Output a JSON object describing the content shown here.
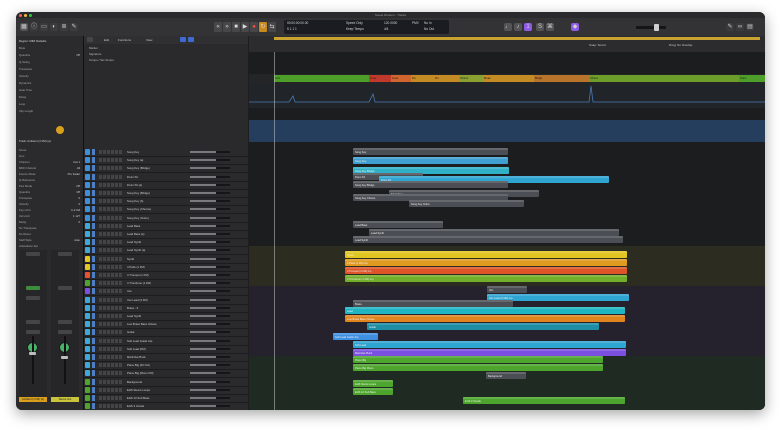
{
  "window": {
    "title": "Sweet Dreams - Tracks"
  },
  "colors": {
    "close": "#ff5f57",
    "min": "#febc2e",
    "max": "#28c840",
    "accent": "#8e5ae6"
  },
  "control_bar": {
    "lcd": {
      "position": "00:00:00:00.00",
      "bars": "5 1 1 1",
      "tempo_label": "Keep Tempo",
      "tempo": "120.0000",
      "signature": "4/4",
      "key": "No In",
      "division": "No Out",
      "time_label": "Speed Only",
      "sample_label": "PMV"
    },
    "icons": [
      "library-icon",
      "inspector-icon",
      "toolbar-icon",
      "smart-controls-icon",
      "mixer-icon",
      "editors-icon",
      "rewind-icon",
      "forward-icon",
      "stop-icon",
      "play-icon",
      "record-icon",
      "cycle-icon",
      "metronome-icon",
      "tuner-icon",
      "count-in-icon",
      "notepad-icon",
      "loop-browser-icon",
      "browser-icon"
    ]
  },
  "inspector": {
    "region_label": "Region: MIDI Defaults",
    "track_label": "Track: Ambient (1 FM) (a)",
    "rows": [
      {
        "label": "Mute",
        "value": ""
      },
      {
        "label": "Quantize",
        "value": "Off"
      },
      {
        "label": "Q-Swing",
        "value": ""
      },
      {
        "label": "Transpose",
        "value": ""
      },
      {
        "label": "Velocity",
        "value": ""
      },
      {
        "label": "Dynamics",
        "value": ""
      },
      {
        "label": "Gate Time",
        "value": ""
      },
      {
        "label": "Delay",
        "value": ""
      },
      {
        "label": "Loop",
        "value": ""
      },
      {
        "label": "Clip Length",
        "value": ""
      },
      {
        "label": "Score",
        "value": ""
      },
      {
        "label": "Icon",
        "value": ""
      },
      {
        "label": "Channel",
        "value": "Inst 1"
      },
      {
        "label": "MIDI Channel",
        "value": "All"
      },
      {
        "label": "Freeze Mode",
        "value": "Pre Fader"
      },
      {
        "label": "Q-Reference",
        "value": ""
      },
      {
        "label": "Flex Mode",
        "value": "Off"
      },
      {
        "label": "Quantize",
        "value": "Off"
      },
      {
        "label": "Transpose",
        "value": "0"
      },
      {
        "label": "Velocity",
        "value": "0"
      },
      {
        "label": "Key Limit",
        "value": "C-2 G8"
      },
      {
        "label": "Vel Limit",
        "value": "1 127"
      },
      {
        "label": "Delay",
        "value": "0"
      },
      {
        "label": "No Transpose",
        "value": ""
      },
      {
        "label": "No Reset",
        "value": ""
      },
      {
        "label": "Staff Style",
        "value": "Auto"
      },
      {
        "label": "Articulation Set",
        "value": ""
      }
    ],
    "strips": [
      {
        "name": "Ambient (1 FM) (a)",
        "setting": "Setting",
        "eq": "EQ",
        "output": "Stereo Out",
        "volume": "-9.4",
        "read": "Read"
      },
      {
        "name": "Stereo Out",
        "setting": "Setting",
        "eq": "EQ",
        "output": "",
        "volume": "0.0",
        "read": "Read"
      }
    ]
  },
  "tracks_header": {
    "edit": "Edit",
    "functions": "Functions",
    "view": "View"
  },
  "global_tracks": [
    "Marker",
    "Signature",
    "Tempo / Set Tempo"
  ],
  "tracks": [
    {
      "name": "Song Key",
      "color": "#3f8fd6"
    },
    {
      "name": "Song Key (a)",
      "color": "#3f8fd6"
    },
    {
      "name": "Song Key (Bridge)",
      "color": "#3f8fd6"
    },
    {
      "name": "Drum Kit",
      "color": "#3f8fd6"
    },
    {
      "name": "Drum Kit (a)",
      "color": "#3f8fd6"
    },
    {
      "name": "Song Key (Bridge)",
      "color": "#3f8fd6"
    },
    {
      "name": "Song Key (b)",
      "color": "#3f8fd6"
    },
    {
      "name": "Song Key (Chorus)",
      "color": "#3f8fd6"
    },
    {
      "name": "Song Key (Outro)",
      "color": "#3f8fd6"
    },
    {
      "name": "Lead Bass",
      "color": "#3fa8d8"
    },
    {
      "name": "Lead Bass (a)",
      "color": "#3fa8d8"
    },
    {
      "name": "Lead Synth",
      "color": "#3fa8d8"
    },
    {
      "name": "Lead Synth (a)",
      "color": "#3fa8d8"
    },
    {
      "name": "Synth",
      "color": "#e2c623"
    },
    {
      "name": "4 Pads (1 FM)",
      "color": "#e2c623"
    },
    {
      "name": "4 Trumpet (1 FM)",
      "color": "#e8522c"
    },
    {
      "name": "4 Trombone (1 FM)",
      "color": "#4ea52e"
    },
    {
      "name": "Vox",
      "color": "#7b4fe0"
    },
    {
      "name": "Vox Lead (3 FM)",
      "color": "#3fa8d8"
    },
    {
      "name": "Brass - #",
      "color": "#3fa8d8"
    },
    {
      "name": "Lead Synth",
      "color": "#3fa8d8"
    },
    {
      "name": "Low Brass Bass Octave",
      "color": "#3fa8d8"
    },
    {
      "name": "Guitar",
      "color": "#3fa8d8"
    },
    {
      "name": "Soft Lead Guitar Arp",
      "color": "#3fa8d8"
    },
    {
      "name": "Soft Lead (FM)",
      "color": "#3fa8d8"
    },
    {
      "name": "Marimba Pluck",
      "color": "#3fa8d8"
    },
    {
      "name": "Piano Big (20 Oct)",
      "color": "#3fa8d8"
    },
    {
      "name": "Piano Big (Mono FM)",
      "color": "#3fa8d8"
    },
    {
      "name": "Background",
      "color": "#4ea52e"
    },
    {
      "name": "EHS Stems Loops",
      "color": "#4ea52e"
    },
    {
      "name": "EHS 10 Sub Bass",
      "color": "#4ea52e"
    },
    {
      "name": "EHS 3 Vocals",
      "color": "#4ea52e"
    },
    {
      "name": "EHS 10 Ambient",
      "color": "#4ea52e"
    }
  ],
  "arrange": {
    "mode": "Snap: Smart",
    "drag": "Drag: No Overlap",
    "markers": [
      {
        "label": "Intro",
        "color": "#4e9e2a"
      },
      {
        "label": "Verse",
        "color": "#c1392b"
      },
      {
        "label": "Verse",
        "color": "#d0652e"
      },
      {
        "label": "Pre",
        "color": "#c48a24"
      },
      {
        "label": "Pre",
        "color": "#c48a24"
      },
      {
        "label": "Chorus",
        "color": "#8aa132"
      },
      {
        "label": "Break",
        "color": "#c48a24"
      },
      {
        "label": "Bridge",
        "color": "#b8742a"
      },
      {
        "label": "Chorus",
        "color": "#6d9e2a"
      },
      {
        "label": "Outro",
        "color": "#4e9e2a"
      }
    ],
    "regions": [
      {
        "label": "Song Key",
        "color": "#4b4e54"
      },
      {
        "label": "Song Key",
        "color": "#3f9fd0"
      },
      {
        "label": "Song Key Bridge",
        "color": "#2fb0c6"
      },
      {
        "label": "Drum Kit",
        "color": "#4b4e54"
      },
      {
        "label": "Drum Kit",
        "color": "#2fa5d2"
      },
      {
        "label": "Song Key Bridge",
        "color": "#4b4e54"
      },
      {
        "label": "Song Key",
        "color": "#4b4e54"
      },
      {
        "label": "Song Key Chorus",
        "color": "#4b4e54"
      },
      {
        "label": "Song Key Outro",
        "color": "#4b4e54"
      },
      {
        "label": "Lead Bass",
        "color": "#4b4e54"
      },
      {
        "label": "Lead Synth",
        "color": "#4b4e54"
      },
      {
        "label": "Lead Synth",
        "color": "#4b4e54"
      },
      {
        "label": "Synth",
        "color": "#e1c621"
      },
      {
        "label": "4 Pads (1 FM).mp",
        "color": "#e09a1f"
      },
      {
        "label": "4 Trumpet (1 FM).mp",
        "color": "#de5429"
      },
      {
        "label": "4 Trombone (1 FM).mp",
        "color": "#71ae2a"
      },
      {
        "label": "Vox",
        "color": "#4b4e54"
      },
      {
        "label": "Vox Lead (3 FM).mp",
        "color": "#2fa5d2"
      },
      {
        "label": "Brass",
        "color": "#4b4e54"
      },
      {
        "label": "Lead",
        "color": "#1fb5c2"
      },
      {
        "label": "Low Brass Bass Octave",
        "color": "#e0851e"
      },
      {
        "label": "Guitar",
        "color": "#1e8ea7"
      },
      {
        "label": "Soft Lead Guitar Arp",
        "color": "#3f8fe2"
      },
      {
        "label": "Soft Lead",
        "color": "#2fa5d2"
      },
      {
        "label": "Marimba Pluck",
        "color": "#7b4fe0"
      },
      {
        "label": "Piano Big",
        "color": "#4ea52e"
      },
      {
        "label": "Piano Big Mono",
        "color": "#4ea52e"
      },
      {
        "label": "Background",
        "color": "#4b4e54"
      },
      {
        "label": "EHS Stems Loops",
        "color": "#4ea52e"
      },
      {
        "label": "EHS 10 Sub Bass",
        "color": "#4ea52e"
      },
      {
        "label": "EHS 3 Vocals",
        "color": "#4ea52e"
      }
    ]
  }
}
